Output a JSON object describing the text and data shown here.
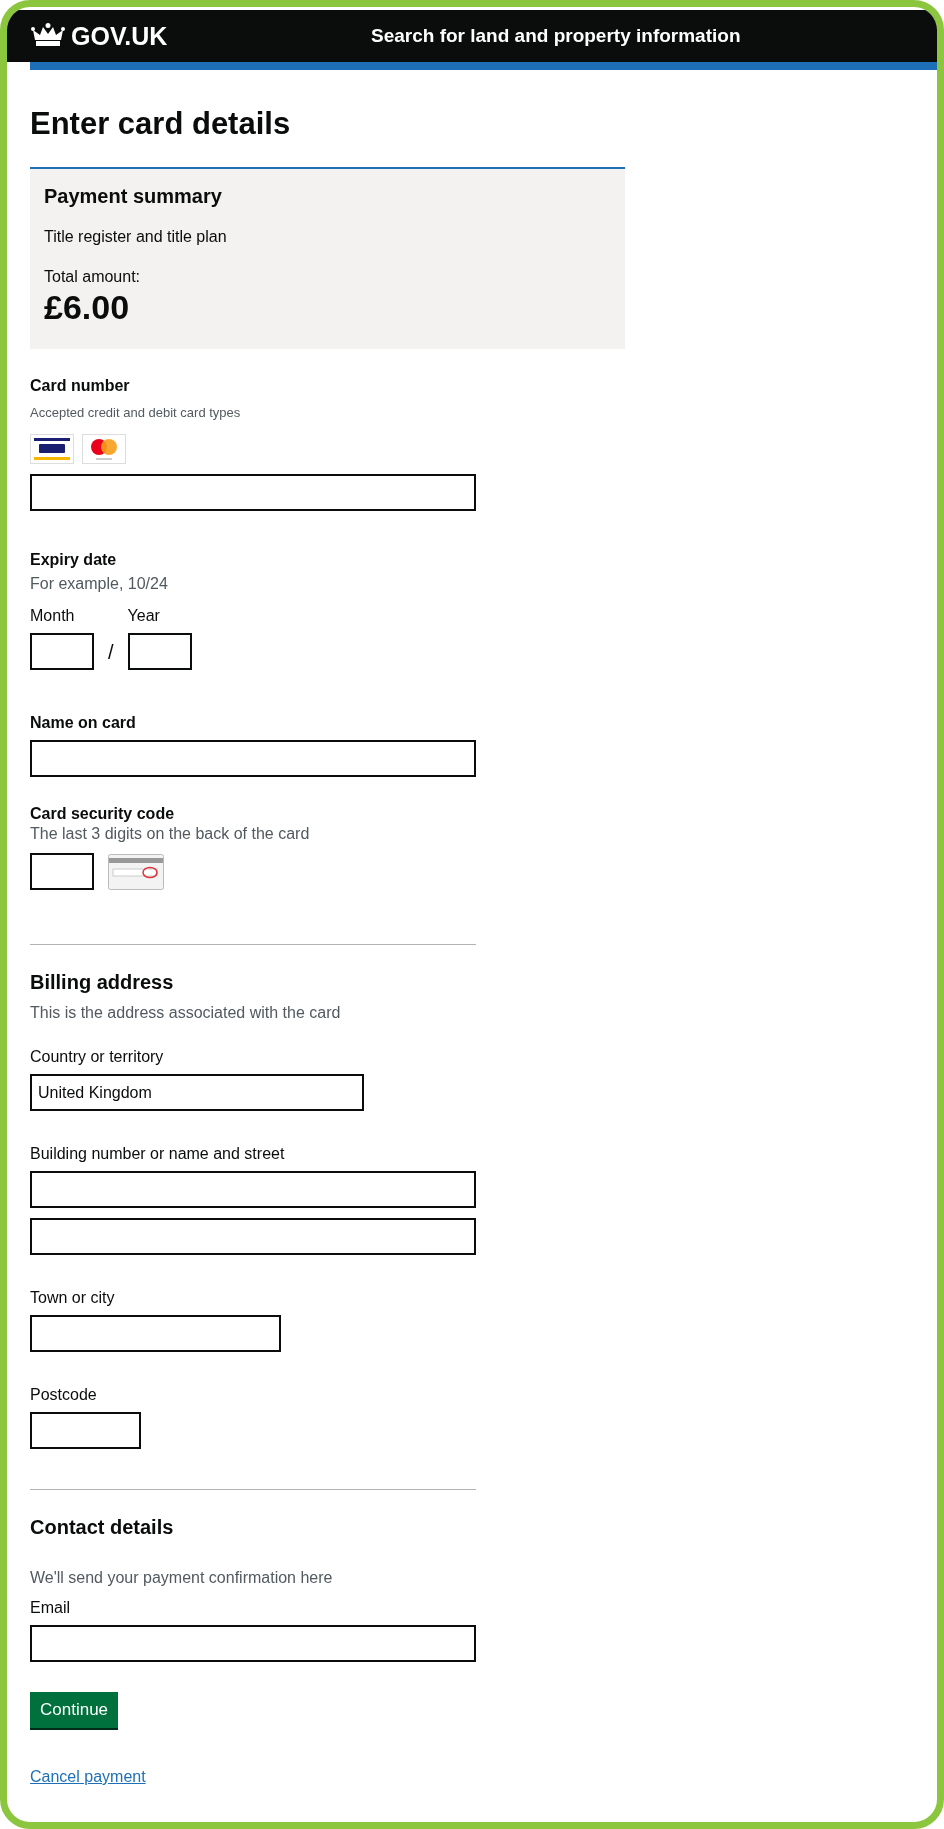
{
  "header": {
    "logo": "GOV.UK",
    "service": "Search for land and property information"
  },
  "page_title": "Enter card details",
  "summary": {
    "heading": "Payment summary",
    "description": "Title register and title plan",
    "total_label": "Total amount:",
    "total": "£6.00"
  },
  "card_number": {
    "label": "Card number",
    "hint": "Accepted credit and debit card types"
  },
  "expiry": {
    "label": "Expiry date",
    "hint": "For example, 10/24",
    "month_label": "Month",
    "year_label": "Year",
    "separator": "/"
  },
  "name_on_card": {
    "label": "Name on card"
  },
  "security_code": {
    "label": "Card security code",
    "hint": "The last 3 digits on the back of the card"
  },
  "billing": {
    "heading": "Billing address",
    "hint": "This is the address associated with the card",
    "fields": [
      {
        "kind": "country",
        "label": "Country or territory",
        "value": "United Kingdom"
      },
      {
        "kind": "address",
        "label": "Building number or name and street"
      },
      {
        "kind": "town",
        "label": "Town or city"
      },
      {
        "kind": "postcode",
        "label": "Postcode"
      }
    ]
  },
  "contact": {
    "heading": "Contact details",
    "hint": "We'll send your payment confirmation here",
    "fields": [
      {
        "kind": "email",
        "label": "Email"
      }
    ]
  },
  "continue_button": "Continue",
  "cancel_link": "Cancel payment"
}
